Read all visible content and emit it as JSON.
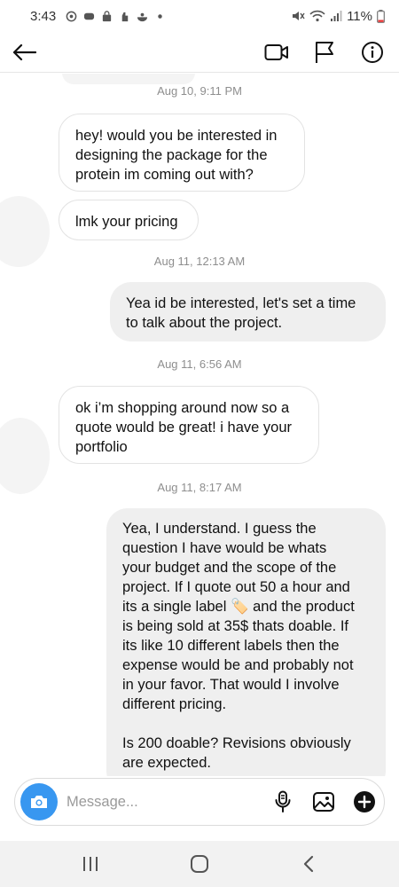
{
  "status_bar": {
    "time": "3:43",
    "battery": "11%",
    "left_icons": [
      "sync-icon",
      "game-icon",
      "bag-icon",
      "hand-icon",
      "food-icon",
      "dot-icon"
    ],
    "right_icons": [
      "mute-icon",
      "wifi-icon",
      "signal-icon",
      "battery-icon"
    ]
  },
  "header": {
    "icons": [
      "back-arrow-icon",
      "video-call-icon",
      "flag-icon",
      "info-icon"
    ]
  },
  "conversation": {
    "timestamps": [
      "Aug 10, 9:11 PM",
      "Aug 11, 12:13 AM",
      "Aug 11, 6:56 AM",
      "Aug 11, 8:17 AM"
    ],
    "messages": [
      {
        "direction": "in",
        "lines": [
          "hey! would you be interested in",
          "designing the package for the",
          "protein im coming out with?"
        ]
      },
      {
        "direction": "in",
        "lines": [
          "lmk your pricing"
        ]
      },
      {
        "direction": "out",
        "lines": [
          "Yea id be interested, let's set a time",
          "to talk about the project."
        ]
      },
      {
        "direction": "in",
        "lines": [
          "ok i’m shopping around now so a",
          "quote would be great! i have your",
          "portfolio"
        ]
      },
      {
        "direction": "out",
        "lines": [
          "Yea, I understand. I guess the",
          "question I have would be whats",
          "your budget and the scope of the",
          "project. If I quote out 50 a hour and",
          "its a single label 🏷️ and the product",
          "is being sold at 35$ thats doable. If",
          "its like 10 different labels then the",
          "expense would be and probably not",
          "in your favor. That would I involve",
          "different pricing.",
          "",
          "Is 200 doable? Revisions obviously",
          "are expected."
        ]
      }
    ]
  },
  "composer": {
    "placeholder": "Message...",
    "value": "",
    "icons": [
      "camera-icon",
      "microphone-icon",
      "gallery-icon",
      "plus-icon"
    ]
  },
  "nav_bar": {
    "icons": [
      "recent-apps-icon",
      "home-icon",
      "back-icon"
    ]
  },
  "colors": {
    "accent": "#3897f0",
    "outgoing_bubble": "#efefef",
    "incoming_border": "#e3e3e3",
    "timestamp": "#8e8e8e"
  }
}
